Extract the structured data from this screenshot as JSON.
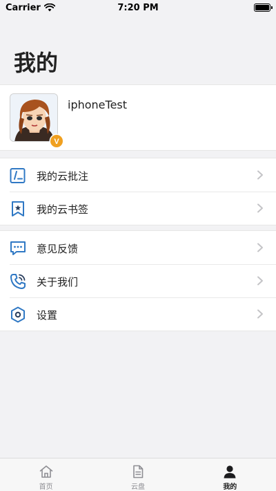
{
  "status_bar": {
    "carrier": "Carrier",
    "time": "7:20 PM"
  },
  "page": {
    "title": "我的"
  },
  "profile": {
    "username": "iphoneTest",
    "badge_letter": "V"
  },
  "menu_groups": [
    {
      "items": [
        {
          "label": "我的云批注",
          "icon": "annotation-icon"
        },
        {
          "label": "我的云书签",
          "icon": "bookmark-icon"
        }
      ]
    },
    {
      "items": [
        {
          "label": "意见反馈",
          "icon": "feedback-icon"
        },
        {
          "label": "关于我们",
          "icon": "phone-icon"
        },
        {
          "label": "设置",
          "icon": "settings-icon"
        }
      ]
    }
  ],
  "tab_bar": {
    "tabs": [
      {
        "label": "首页",
        "icon": "home-icon",
        "active": false
      },
      {
        "label": "云盘",
        "icon": "document-icon",
        "active": false
      },
      {
        "label": "我的",
        "icon": "person-icon",
        "active": true
      }
    ]
  },
  "colors": {
    "accent": "#2f78c4",
    "badge": "#f0a020",
    "background": "#f2f2f4"
  }
}
